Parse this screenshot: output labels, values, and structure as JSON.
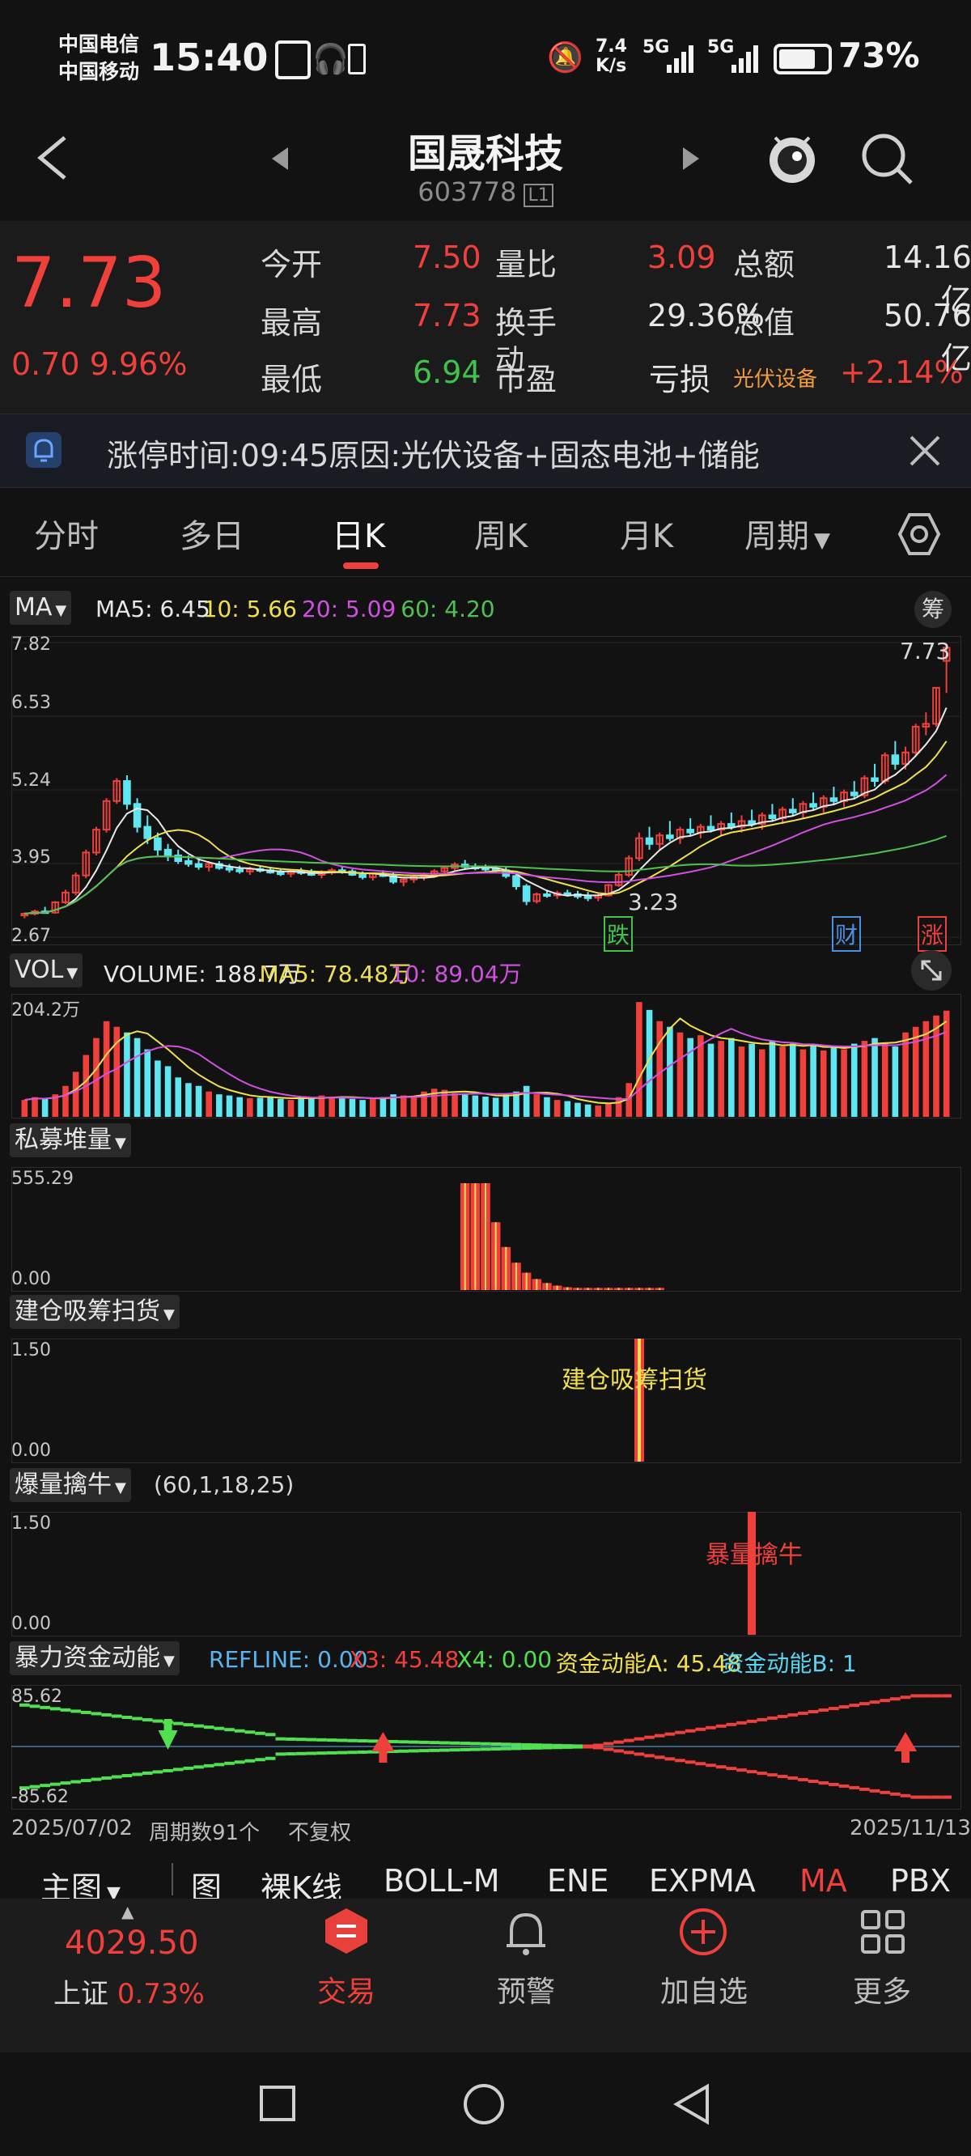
{
  "status_bar": {
    "carrier1": "中国电信",
    "carrier2": "中国移动",
    "time": "15:40",
    "net_speed_top": "7.4",
    "net_speed_bottom": "K/s",
    "signal1": "5G",
    "signal2": "5G",
    "battery": "73%"
  },
  "header": {
    "title": "国晟科技",
    "code": "603778",
    "code_badge": "L1"
  },
  "quote": {
    "price": "7.73",
    "change": "0.70",
    "change_pct": "9.96%",
    "fields": [
      {
        "label": "今开",
        "value": "7.50",
        "color": "#f0403c"
      },
      {
        "label": "最高",
        "value": "7.73",
        "color": "#f0403c"
      },
      {
        "label": "最低",
        "value": "6.94",
        "color": "#3fc34b"
      },
      {
        "label": "量比",
        "value": "3.09",
        "color": "#f0403c"
      },
      {
        "label": "换手",
        "value": "29.36%",
        "color": "#e6e6e6"
      },
      {
        "label": "市盈",
        "value": "",
        "color": "#e6e6e6"
      },
      {
        "label": "总额",
        "value": "14.16亿",
        "color": "#e6e6e6"
      },
      {
        "label": "总值",
        "value": "50.76亿",
        "color": "#e6e6e6"
      }
    ],
    "pe_suffix": "动",
    "pe_value": "亏损",
    "sector": "光伏设备",
    "sector_change": "+2.14%"
  },
  "notice": {
    "text": "涨停时间:09:45原因:光伏设备+固态电池+储能"
  },
  "tabs": [
    "分时",
    "多日",
    "日K",
    "周K",
    "月K",
    "周期"
  ],
  "active_tab": "日K",
  "kline": {
    "indicator": "MA",
    "chip_button": "筹",
    "legend": [
      {
        "text": "MA5: 6.45",
        "color": "#e8e8e8"
      },
      {
        "text": "10: 5.66",
        "color": "#f0e050"
      },
      {
        "text": "20: 5.09",
        "color": "#d050e0"
      },
      {
        "text": "60: 4.20",
        "color": "#50c050"
      }
    ],
    "yaxis": [
      "7.82",
      "6.53",
      "5.24",
      "3.95",
      "2.67"
    ],
    "max_label": "7.73",
    "min_label": "3.23",
    "markers": [
      {
        "text": "跌",
        "color": "#3fc34b"
      },
      {
        "text": "财",
        "color": "#4a90e2"
      },
      {
        "text": "涨",
        "color": "#f0403c"
      }
    ]
  },
  "volume": {
    "indicator": "VOL",
    "legend": [
      {
        "text": "VOLUME: 188.7万",
        "color": "#e8e8e8"
      },
      {
        "text": "MA5: 78.48万",
        "color": "#f0e050"
      },
      {
        "text": "10: 89.04万",
        "color": "#d050e0"
      }
    ],
    "ymax": "204.2万"
  },
  "private_fund": {
    "indicator": "私募堆量",
    "ymax": "555.29",
    "ymin": "0.00"
  },
  "accumulate": {
    "indicator": "建仓吸筹扫货",
    "ymax": "1.50",
    "ymin": "0.00",
    "annotation": "建仓吸筹扫货"
  },
  "volume_bull": {
    "indicator": "爆量擒牛",
    "params": "(60,1,18,25)",
    "ymax": "1.50",
    "ymin": "0.00",
    "annotation": "暴量擒牛"
  },
  "capital": {
    "indicator": "暴力资金动能",
    "legend": [
      {
        "text": "REFLINE: 0.00",
        "color": "#5ab4f0"
      },
      {
        "text": "X3: 45.48",
        "color": "#f0403c"
      },
      {
        "text": "X4: 0.00",
        "color": "#50e050"
      },
      {
        "text": "资金动能A: 45.48",
        "color": "#f0e050"
      },
      {
        "text": "资金动能B: 1",
        "color": "#5ad4f0"
      }
    ],
    "ymax": "85.62",
    "ymin": "-85.62"
  },
  "footer_info": {
    "start_date": "2025/07/02",
    "period_count": "周期数91个",
    "adjust": "不复权",
    "end_date": "2025/11/13"
  },
  "indicator_bar": {
    "main_label": "主图",
    "items": [
      "图",
      "裸K线",
      "BOLL-M",
      "ENE",
      "EXPMA",
      "MA",
      "PBX"
    ],
    "active": "MA"
  },
  "bottom_nav": {
    "index_value": "4029.50",
    "index_name": "上证",
    "index_change": "0.73%",
    "items": [
      "交易",
      "预警",
      "加自选",
      "更多"
    ]
  },
  "colors": {
    "up": "#f0403c",
    "down": "#5fe6f0",
    "ma5": "#e8e8e8",
    "ma10": "#f0e050",
    "ma20": "#d050e0",
    "ma60": "#50c050"
  },
  "chart_data": {
    "type": "candlestick",
    "candles": [
      [
        3.05,
        3.1,
        3.0,
        3.08
      ],
      [
        3.08,
        3.15,
        3.05,
        3.12
      ],
      [
        3.12,
        3.2,
        3.08,
        3.1
      ],
      [
        3.1,
        3.3,
        3.08,
        3.28
      ],
      [
        3.28,
        3.5,
        3.25,
        3.45
      ],
      [
        3.45,
        3.8,
        3.4,
        3.75
      ],
      [
        3.75,
        4.2,
        3.7,
        4.15
      ],
      [
        4.15,
        4.6,
        4.1,
        4.55
      ],
      [
        4.55,
        5.1,
        4.5,
        5.05
      ],
      [
        5.05,
        5.45,
        5.0,
        5.4
      ],
      [
        5.4,
        5.5,
        4.9,
        5.0
      ],
      [
        5.0,
        5.1,
        4.5,
        4.6
      ],
      [
        4.6,
        4.8,
        4.3,
        4.4
      ],
      [
        4.4,
        4.5,
        4.1,
        4.2
      ],
      [
        4.2,
        4.3,
        4.0,
        4.1
      ],
      [
        4.1,
        4.2,
        3.95,
        4.0
      ],
      [
        4.0,
        4.1,
        3.9,
        3.95
      ],
      [
        3.95,
        4.05,
        3.85,
        3.9
      ],
      [
        3.9,
        4.0,
        3.82,
        3.95
      ],
      [
        3.95,
        4.0,
        3.85,
        3.88
      ],
      [
        3.88,
        3.95,
        3.8,
        3.85
      ],
      [
        3.85,
        3.92,
        3.78,
        3.82
      ],
      [
        3.82,
        3.9,
        3.76,
        3.86
      ],
      [
        3.86,
        3.92,
        3.8,
        3.84
      ],
      [
        3.84,
        3.9,
        3.78,
        3.8
      ],
      [
        3.8,
        3.86,
        3.74,
        3.78
      ],
      [
        3.78,
        3.84,
        3.72,
        3.82
      ],
      [
        3.82,
        3.88,
        3.76,
        3.8
      ],
      [
        3.8,
        3.86,
        3.74,
        3.76
      ],
      [
        3.76,
        3.84,
        3.7,
        3.8
      ],
      [
        3.8,
        3.88,
        3.76,
        3.84
      ],
      [
        3.84,
        3.9,
        3.78,
        3.82
      ],
      [
        3.82,
        3.86,
        3.74,
        3.76
      ],
      [
        3.76,
        3.82,
        3.68,
        3.72
      ],
      [
        3.72,
        3.8,
        3.66,
        3.78
      ],
      [
        3.78,
        3.84,
        3.72,
        3.74
      ],
      [
        3.74,
        3.8,
        3.6,
        3.64
      ],
      [
        3.64,
        3.72,
        3.56,
        3.68
      ],
      [
        3.68,
        3.76,
        3.62,
        3.72
      ],
      [
        3.72,
        3.8,
        3.66,
        3.76
      ],
      [
        3.76,
        3.86,
        3.72,
        3.82
      ],
      [
        3.82,
        3.92,
        3.78,
        3.88
      ],
      [
        3.88,
        3.98,
        3.84,
        3.94
      ],
      [
        3.94,
        4.02,
        3.86,
        3.9
      ],
      [
        3.9,
        3.96,
        3.84,
        3.88
      ],
      [
        3.88,
        3.94,
        3.82,
        3.86
      ],
      [
        3.86,
        3.92,
        3.8,
        3.84
      ],
      [
        3.84,
        3.9,
        3.7,
        3.74
      ],
      [
        3.74,
        3.8,
        3.5,
        3.56
      ],
      [
        3.56,
        3.6,
        3.23,
        3.3
      ],
      [
        3.3,
        3.45,
        3.26,
        3.42
      ],
      [
        3.42,
        3.5,
        3.36,
        3.4
      ],
      [
        3.4,
        3.48,
        3.34,
        3.44
      ],
      [
        3.44,
        3.5,
        3.38,
        3.42
      ],
      [
        3.42,
        3.48,
        3.34,
        3.38
      ],
      [
        3.38,
        3.46,
        3.3,
        3.36
      ],
      [
        3.36,
        3.44,
        3.3,
        3.4
      ],
      [
        3.4,
        3.6,
        3.38,
        3.58
      ],
      [
        3.58,
        3.8,
        3.55,
        3.76
      ],
      [
        3.76,
        4.1,
        3.72,
        4.05
      ],
      [
        4.05,
        4.5,
        4.0,
        4.4
      ],
      [
        4.4,
        4.6,
        4.2,
        4.3
      ],
      [
        4.3,
        4.5,
        4.2,
        4.45
      ],
      [
        4.45,
        4.7,
        4.35,
        4.4
      ],
      [
        4.4,
        4.6,
        4.3,
        4.55
      ],
      [
        4.55,
        4.75,
        4.45,
        4.5
      ],
      [
        4.5,
        4.65,
        4.4,
        4.6
      ],
      [
        4.6,
        4.8,
        4.5,
        4.55
      ],
      [
        4.55,
        4.7,
        4.45,
        4.65
      ],
      [
        4.65,
        4.85,
        4.55,
        4.6
      ],
      [
        4.6,
        4.8,
        4.5,
        4.7
      ],
      [
        4.7,
        4.9,
        4.6,
        4.65
      ],
      [
        4.65,
        4.85,
        4.55,
        4.8
      ],
      [
        4.8,
        5.0,
        4.7,
        4.75
      ],
      [
        4.75,
        4.95,
        4.65,
        4.9
      ],
      [
        4.9,
        5.1,
        4.8,
        4.85
      ],
      [
        4.85,
        5.05,
        4.75,
        5.0
      ],
      [
        5.0,
        5.2,
        4.9,
        4.95
      ],
      [
        4.95,
        5.15,
        4.85,
        5.1
      ],
      [
        5.1,
        5.3,
        5.0,
        5.05
      ],
      [
        5.05,
        5.25,
        4.95,
        5.2
      ],
      [
        5.2,
        5.4,
        5.1,
        5.15
      ],
      [
        5.15,
        5.5,
        5.1,
        5.45
      ],
      [
        5.45,
        5.7,
        5.3,
        5.4
      ],
      [
        5.4,
        5.9,
        5.35,
        5.85
      ],
      [
        5.85,
        6.1,
        5.6,
        5.7
      ],
      [
        5.7,
        6.0,
        5.6,
        5.9
      ],
      [
        5.9,
        6.4,
        5.85,
        6.35
      ],
      [
        6.35,
        6.6,
        6.2,
        6.4
      ],
      [
        6.4,
        7.03,
        6.35,
        7.03
      ],
      [
        7.5,
        7.73,
        6.94,
        7.73
      ]
    ],
    "volume": [
      30,
      35,
      32,
      40,
      55,
      80,
      110,
      140,
      170,
      160,
      150,
      140,
      120,
      100,
      90,
      70,
      60,
      55,
      45,
      40,
      38,
      35,
      33,
      34,
      36,
      32,
      30,
      33,
      35,
      38,
      36,
      34,
      32,
      30,
      33,
      35,
      40,
      38,
      36,
      45,
      50,
      48,
      42,
      40,
      38,
      36,
      34,
      40,
      45,
      55,
      40,
      35,
      30,
      28,
      25,
      22,
      20,
      25,
      35,
      60,
      204,
      190,
      170,
      160,
      150,
      140,
      145,
      130,
      135,
      140,
      125,
      130,
      120,
      135,
      125,
      130,
      120,
      128,
      118,
      125,
      120,
      130,
      135,
      140,
      130,
      125,
      150,
      160,
      170,
      180,
      188.7
    ],
    "ylim": [
      2.67,
      7.82
    ],
    "vol_max": 204.2
  }
}
